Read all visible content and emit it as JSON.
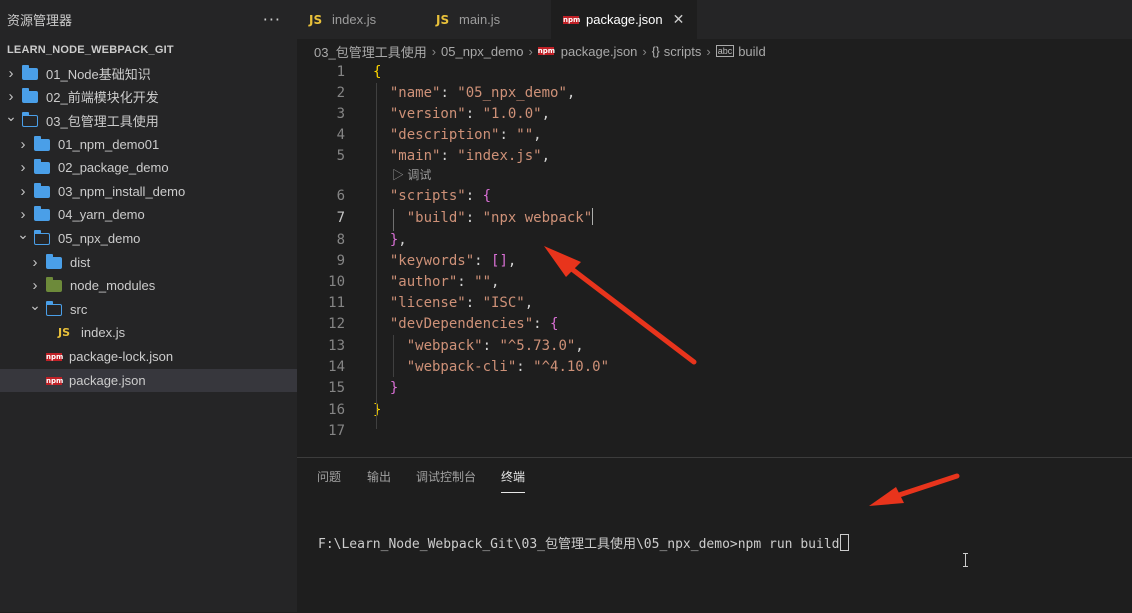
{
  "explorer": {
    "title": "资源管理器",
    "more_label": "···",
    "root": "LEARN_NODE_WEBPACK_GIT",
    "items": [
      {
        "label": "01_Node基础知识",
        "type": "folder",
        "depth": 0,
        "state": "closed"
      },
      {
        "label": "02_前端模块化开发",
        "type": "folder",
        "depth": 0,
        "state": "closed"
      },
      {
        "label": "03_包管理工具使用",
        "type": "folder",
        "depth": 0,
        "state": "open"
      },
      {
        "label": "01_npm_demo01",
        "type": "folder",
        "depth": 1,
        "state": "closed"
      },
      {
        "label": "02_package_demo",
        "type": "folder",
        "depth": 1,
        "state": "closed"
      },
      {
        "label": "03_npm_install_demo",
        "type": "folder",
        "depth": 1,
        "state": "closed"
      },
      {
        "label": "04_yarn_demo",
        "type": "folder",
        "depth": 1,
        "state": "closed"
      },
      {
        "label": "05_npx_demo",
        "type": "folder",
        "depth": 1,
        "state": "open"
      },
      {
        "label": "dist",
        "type": "folder",
        "depth": 2,
        "state": "closed"
      },
      {
        "label": "node_modules",
        "type": "folder-nm",
        "depth": 2,
        "state": "closed"
      },
      {
        "label": "src",
        "type": "folder",
        "depth": 2,
        "state": "open"
      },
      {
        "label": "index.js",
        "type": "js",
        "depth": 3
      },
      {
        "label": "package-lock.json",
        "type": "npm",
        "depth": 2
      },
      {
        "label": "package.json",
        "type": "npm",
        "depth": 2,
        "selected": true
      }
    ]
  },
  "tabs": [
    {
      "label": "index.js",
      "icon": "JS",
      "active": false
    },
    {
      "label": "main.js",
      "icon": "JS",
      "active": false
    },
    {
      "label": "package.json",
      "icon": "npm",
      "active": true,
      "close": "✕"
    }
  ],
  "breadcrumb": {
    "parts": [
      "03_包管理工具使用",
      "05_npx_demo",
      "package.json",
      "scripts",
      "build"
    ],
    "scripts_icon": "{}",
    "build_icon": "abc"
  },
  "editor": {
    "codelens": "▷ 调试",
    "lines": [
      {
        "n": "1",
        "html": "<span class='br1'>{</span>"
      },
      {
        "n": "2",
        "html": "  <span class='key'>\"name\"</span><span class='punc'>: </span><span class='str'>\"05_npx_demo\"</span><span class='punc'>,</span>"
      },
      {
        "n": "3",
        "html": "  <span class='key'>\"version\"</span><span class='punc'>: </span><span class='str'>\"1.0.0\"</span><span class='punc'>,</span>"
      },
      {
        "n": "4",
        "html": "  <span class='key'>\"description\"</span><span class='punc'>: </span><span class='str'>\"\"</span><span class='punc'>,</span>"
      },
      {
        "n": "5",
        "html": "  <span class='key'>\"main\"</span><span class='punc'>: </span><span class='str'>\"index.js\"</span><span class='punc'>,</span>"
      },
      {
        "n": "6",
        "html": "  <span class='key'>\"scripts\"</span><span class='punc'>: </span><span class='br2'>{</span>"
      },
      {
        "n": "7",
        "html": "    <span class='key'>\"build\"</span><span class='punc'>: </span><span class='str'>\"npx webpack\"</span>"
      },
      {
        "n": "8",
        "html": "  <span class='br2'>}</span><span class='punc'>,</span>"
      },
      {
        "n": "9",
        "html": "  <span class='key'>\"keywords\"</span><span class='punc'>: </span><span class='br2'>[]</span><span class='punc'>,</span>"
      },
      {
        "n": "10",
        "html": "  <span class='key'>\"author\"</span><span class='punc'>: </span><span class='str'>\"\"</span><span class='punc'>,</span>"
      },
      {
        "n": "11",
        "html": "  <span class='key'>\"license\"</span><span class='punc'>: </span><span class='str'>\"ISC\"</span><span class='punc'>,</span>"
      },
      {
        "n": "12",
        "html": "  <span class='key'>\"devDependencies\"</span><span class='punc'>: </span><span class='br2'>{</span>"
      },
      {
        "n": "13",
        "html": "    <span class='key'>\"webpack\"</span><span class='punc'>: </span><span class='str'>\"^5.73.0\"</span><span class='punc'>,</span>"
      },
      {
        "n": "14",
        "html": "    <span class='key'>\"webpack-cli\"</span><span class='punc'>: </span><span class='str'>\"^4.10.0\"</span>"
      },
      {
        "n": "15",
        "html": "  <span class='br2'>}</span>"
      },
      {
        "n": "16",
        "html": "<span class='br1'>}</span>"
      },
      {
        "n": "17",
        "html": ""
      }
    ]
  },
  "panel": {
    "tabs": [
      "问题",
      "输出",
      "调试控制台",
      "终端"
    ],
    "active_tab": "终端",
    "terminal_line": "F:\\Learn_Node_Webpack_Git\\03_包管理工具使用\\05_npx_demo>npm run build"
  },
  "colors": {
    "annotation_arrow": "#e8341c",
    "folder": "#4a9fe8",
    "js": "#e8c03a",
    "npm": "#c12127"
  }
}
